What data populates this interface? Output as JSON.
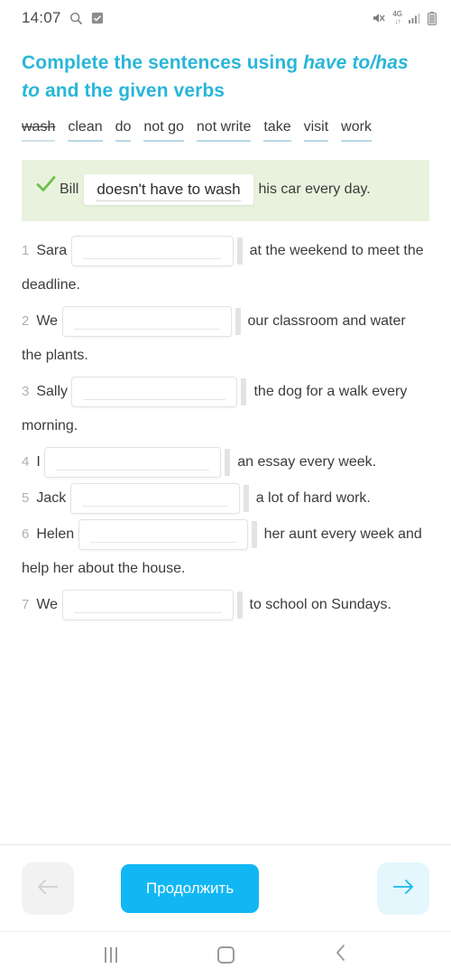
{
  "statusbar": {
    "time": "14:07",
    "left_icons": [
      "search-icon",
      "checkbox-icon"
    ],
    "right_icons": [
      "mute-icon",
      "4g-data-icon",
      "signal-icon",
      "battery-icon"
    ],
    "network_label": "4G"
  },
  "exercise": {
    "title_part1": "Complete the sentences using ",
    "title_emphasis1": "have to/has to",
    "title_part2": " and the given verbs",
    "title_full": "Complete the sentences using have to/has to and the given verbs",
    "wordbank": [
      {
        "word": "wash",
        "used": true
      },
      {
        "word": "clean",
        "used": false
      },
      {
        "word": "do",
        "used": false
      },
      {
        "word": "not go",
        "used": false
      },
      {
        "word": "not write",
        "used": false
      },
      {
        "word": "take",
        "used": false
      },
      {
        "word": "visit",
        "used": false
      },
      {
        "word": "work",
        "used": false
      }
    ],
    "example": {
      "status": "correct",
      "subject": "Bill",
      "answer": "doesn't have to wash",
      "tail": "his car every day."
    },
    "questions": [
      {
        "num": "1",
        "subject": "Sara",
        "value": "",
        "input_width": 180,
        "tail": "at the weekend to meet the deadline."
      },
      {
        "num": "2",
        "subject": "We",
        "value": "",
        "input_width": 188,
        "tail": "our classroom and water the plants."
      },
      {
        "num": "3",
        "subject": "Sally",
        "value": "",
        "input_width": 184,
        "tail": "the dog for a walk every morning."
      },
      {
        "num": "4",
        "subject": "I",
        "value": "",
        "input_width": 196,
        "tail": "an essay every week."
      },
      {
        "num": "5",
        "subject": "Jack",
        "value": "",
        "input_width": 188,
        "tail": "a lot of hard work."
      },
      {
        "num": "6",
        "subject": "Helen",
        "value": "",
        "input_width": 188,
        "tail": "her aunt every week and help her about the house."
      },
      {
        "num": "7",
        "subject": "We",
        "value": "",
        "input_width": 190,
        "tail": "to school on Sundays."
      }
    ]
  },
  "footer": {
    "prev_label": "←",
    "continue_label": "Продолжить",
    "next_label": "→"
  },
  "androidnav": {
    "recents": "recents-icon",
    "home": "home-icon",
    "back": "back-icon"
  },
  "colors": {
    "accent": "#11b7f3",
    "title": "#29b6d8",
    "example_bg": "#e8f2dd",
    "check_green": "#6cbf4a",
    "next_bg": "#e3f7fd"
  }
}
